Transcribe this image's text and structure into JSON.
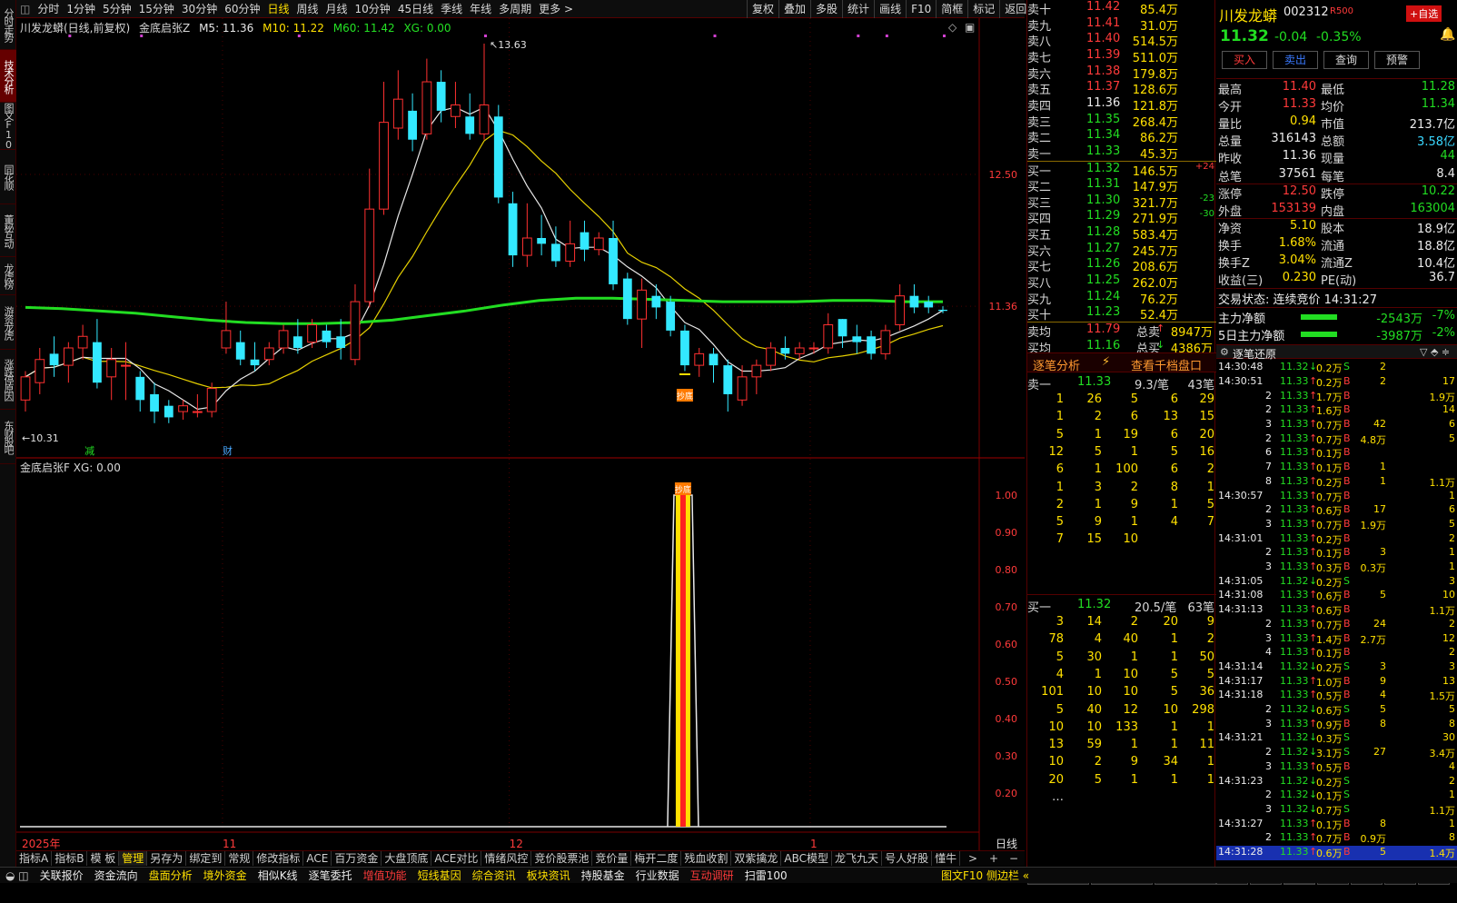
{
  "left_tabs": [
    "分时走势",
    "技术分析",
    "图文F10",
    "同花顺F10",
    "董秘互动",
    "龙虎榜",
    "游资龙虎",
    "涨跌停原因",
    "东财股吧"
  ],
  "periods": [
    "分时",
    "1分钟",
    "5分钟",
    "15分钟",
    "30分钟",
    "60分钟",
    "日线",
    "周线",
    "月线",
    "10分钟",
    "45日线",
    "季线",
    "年线",
    "多周期",
    "更多 >"
  ],
  "active_period": "日线",
  "right_tools": [
    "复权",
    "叠加",
    "多股",
    "统计",
    "画线",
    "F10",
    "简框",
    "标记",
    "返回"
  ],
  "chart_header": {
    "title": "川发龙蟒(日线,前复权)",
    "indicator": "金底启张Z",
    "m5": "M5: 11.36",
    "m10": "M10: 11.22",
    "m60": "M60: 11.42",
    "xg": "XG: 0.00"
  },
  "sub_header": {
    "indicator": "金底启张F",
    "xg": "XG: 0.00"
  },
  "price_axis": [
    {
      "v": "12.50",
      "p": 12.5
    },
    {
      "v": "11.36",
      "p": 11.36
    }
  ],
  "hi_label": "13.63",
  "lo_label": "10.31",
  "markers": {
    "jian": "减",
    "cai": "财",
    "chaodi": "抄底"
  },
  "sub_axis": [
    "1.00",
    "0.90",
    "0.80",
    "0.70",
    "0.60",
    "0.50",
    "0.40",
    "0.30",
    "0.20"
  ],
  "date_labels": [
    {
      "t": "2025年",
      "i": 0
    },
    {
      "t": "11",
      "i": 14
    },
    {
      "t": "12",
      "i": 34
    },
    {
      "t": "1",
      "i": 55
    }
  ],
  "period_corner": "日线",
  "candles": [
    [
      10.55,
      10.75,
      10.45,
      10.8
    ],
    [
      10.7,
      10.9,
      10.6,
      11.0
    ],
    [
      10.95,
      10.85,
      10.75,
      11.1
    ],
    [
      10.85,
      11.0,
      10.7,
      11.05
    ],
    [
      11.0,
      11.1,
      10.9,
      11.2
    ],
    [
      11.05,
      10.7,
      10.65,
      11.25
    ],
    [
      10.75,
      10.9,
      10.55,
      11.0
    ],
    [
      10.85,
      10.85,
      10.55,
      11.05
    ],
    [
      10.75,
      10.55,
      10.45,
      10.8
    ],
    [
      10.6,
      10.45,
      10.35,
      10.7
    ],
    [
      10.5,
      10.4,
      10.35,
      10.55
    ],
    [
      10.45,
      10.5,
      10.38,
      10.55
    ],
    [
      10.45,
      10.45,
      10.4,
      10.6
    ],
    [
      10.45,
      10.65,
      10.4,
      10.7
    ],
    [
      11.0,
      11.15,
      10.95,
      11.4
    ],
    [
      11.05,
      10.9,
      10.85,
      11.15
    ],
    [
      10.9,
      10.85,
      10.8,
      11.05
    ],
    [
      10.9,
      11.0,
      10.85,
      11.05
    ],
    [
      11.0,
      11.15,
      10.95,
      11.2
    ],
    [
      11.1,
      11.0,
      10.95,
      11.25
    ],
    [
      11.05,
      11.2,
      11.0,
      11.25
    ],
    [
      11.15,
      11.05,
      11.0,
      11.2
    ],
    [
      11.1,
      11.0,
      10.9,
      11.25
    ],
    [
      10.9,
      11.4,
      10.85,
      11.55
    ],
    [
      11.4,
      12.2,
      11.35,
      12.55
    ],
    [
      12.2,
      12.95,
      12.15,
      13.3
    ],
    [
      12.9,
      13.15,
      12.8,
      13.4
    ],
    [
      13.05,
      12.8,
      12.7,
      13.2
    ],
    [
      12.85,
      13.3,
      12.8,
      13.5
    ],
    [
      13.3,
      13.05,
      12.95,
      13.4
    ],
    [
      13.0,
      13.1,
      12.9,
      13.3
    ],
    [
      13.0,
      12.85,
      12.8,
      13.2
    ],
    [
      12.85,
      13.1,
      12.8,
      13.63
    ],
    [
      13.0,
      12.3,
      12.25,
      13.1
    ],
    [
      12.25,
      11.8,
      11.7,
      12.35
    ],
    [
      11.8,
      11.95,
      11.7,
      12.25
    ],
    [
      11.95,
      11.9,
      11.8,
      12.15
    ],
    [
      11.9,
      11.75,
      11.7,
      12.05
    ],
    [
      11.75,
      11.9,
      11.7,
      12.1
    ],
    [
      12.0,
      11.85,
      11.75,
      12.1
    ],
    [
      11.85,
      11.95,
      11.8,
      12.0
    ],
    [
      11.95,
      11.55,
      11.5,
      12.1
    ],
    [
      11.6,
      11.25,
      11.2,
      11.65
    ],
    [
      11.25,
      11.5,
      11.0,
      11.6
    ],
    [
      11.45,
      11.35,
      11.25,
      11.55
    ],
    [
      11.4,
      11.15,
      11.1,
      11.45
    ],
    [
      11.15,
      10.85,
      10.8,
      11.2
    ],
    [
      10.85,
      10.95,
      10.75,
      11.0
    ],
    [
      10.95,
      10.85,
      10.7,
      11.0
    ],
    [
      10.85,
      10.6,
      10.45,
      10.9
    ],
    [
      10.55,
      10.75,
      10.5,
      10.85
    ],
    [
      10.75,
      10.85,
      10.6,
      10.9
    ],
    [
      10.85,
      11.0,
      10.8,
      11.05
    ],
    [
      11.0,
      10.95,
      10.9,
      11.1
    ],
    [
      10.95,
      11.0,
      10.9,
      11.05
    ],
    [
      11.0,
      11.0,
      10.95,
      11.05
    ],
    [
      11.0,
      11.2,
      10.95,
      11.3
    ],
    [
      11.25,
      11.1,
      11.0,
      11.25
    ],
    [
      11.1,
      11.05,
      10.95,
      11.2
    ],
    [
      11.1,
      10.95,
      10.9,
      11.15
    ],
    [
      10.95,
      11.15,
      10.9,
      11.2
    ],
    [
      11.2,
      11.45,
      11.15,
      11.55
    ],
    [
      11.45,
      11.35,
      11.3,
      11.55
    ],
    [
      11.4,
      11.35,
      11.3,
      11.45
    ],
    [
      11.33,
      11.32,
      11.3,
      11.36
    ]
  ],
  "m60_line": [
    11.35,
    11.34,
    11.32,
    11.3,
    11.27,
    11.24,
    11.22,
    11.21,
    11.21,
    11.22,
    11.24,
    11.28,
    11.32,
    11.37,
    11.41,
    11.43,
    11.43,
    11.42,
    11.41,
    11.4,
    11.4,
    11.4,
    11.41,
    11.41,
    11.4,
    11.4
  ],
  "orderbook": {
    "asks": [
      [
        "卖十",
        "11.42",
        "85.4万"
      ],
      [
        "卖九",
        "11.41",
        "31.0万"
      ],
      [
        "卖八",
        "11.40",
        "514.5万"
      ],
      [
        "卖七",
        "11.39",
        "511.0万"
      ],
      [
        "卖六",
        "11.38",
        "179.8万"
      ],
      [
        "卖五",
        "11.37",
        "128.6万"
      ],
      [
        "卖四",
        "11.36",
        "121.8万"
      ],
      [
        "卖三",
        "11.35",
        "268.4万"
      ],
      [
        "卖二",
        "11.34",
        "86.2万"
      ],
      [
        "卖一",
        "11.33",
        "45.3万"
      ]
    ],
    "bids": [
      [
        "买一",
        "11.32",
        "146.5万",
        "+24"
      ],
      [
        "买二",
        "11.31",
        "147.9万",
        ""
      ],
      [
        "买三",
        "11.30",
        "321.7万",
        "-23"
      ],
      [
        "买四",
        "11.29",
        "271.9万",
        "-30"
      ],
      [
        "买五",
        "11.28",
        "583.4万",
        ""
      ],
      [
        "买六",
        "11.27",
        "245.7万",
        ""
      ],
      [
        "买七",
        "11.26",
        "208.6万",
        ""
      ],
      [
        "买八",
        "11.25",
        "262.0万",
        ""
      ],
      [
        "买九",
        "11.24",
        "76.2万",
        ""
      ],
      [
        "买十",
        "11.23",
        "52.4万",
        ""
      ]
    ],
    "avg_sell": [
      "卖均",
      "11.79",
      "总卖",
      "8947万"
    ],
    "avg_buy": [
      "买均",
      "11.16",
      "总买",
      "4386万"
    ],
    "zb_title": "逐笔分析",
    "zb_link": "查看千档盘口",
    "sell1_head": [
      "卖一",
      "11.33",
      "9.3/笔",
      "43笔"
    ],
    "sell1_grid": [
      [
        "1",
        "26",
        "5",
        "6",
        "29"
      ],
      [
        "1",
        "2",
        "6",
        "13",
        "15"
      ],
      [
        "5",
        "1",
        "19",
        "6",
        "20"
      ],
      [
        "12",
        "5",
        "1",
        "5",
        "16"
      ],
      [
        "6",
        "1",
        "100",
        "6",
        "2"
      ],
      [
        "1",
        "3",
        "2",
        "8",
        "1"
      ],
      [
        "2",
        "1",
        "9",
        "1",
        "5"
      ],
      [
        "5",
        "9",
        "1",
        "4",
        "7"
      ],
      [
        "7",
        "15",
        "10",
        "",
        ""
      ]
    ],
    "buy1_head": [
      "买一",
      "11.32",
      "20.5/笔",
      "63笔"
    ],
    "buy1_grid": [
      [
        "3",
        "14",
        "2",
        "20",
        "9"
      ],
      [
        "78",
        "4",
        "40",
        "1",
        "2"
      ],
      [
        "5",
        "30",
        "1",
        "1",
        "50"
      ],
      [
        "4",
        "1",
        "10",
        "5",
        "5"
      ],
      [
        "101",
        "10",
        "10",
        "5",
        "36"
      ],
      [
        "5",
        "40",
        "12",
        "10",
        "298"
      ],
      [
        "10",
        "10",
        "133",
        "1",
        "1"
      ],
      [
        "13",
        "59",
        "1",
        "1",
        "11"
      ],
      [
        "10",
        "2",
        "9",
        "34",
        "1"
      ],
      [
        "20",
        "5",
        "1",
        "1",
        "1"
      ],
      [
        "…",
        "",
        "",
        "",
        ""
      ]
    ]
  },
  "info": {
    "name": "川发龙蟒",
    "code": "002312",
    "tag": "R500",
    "add_btn": "+自选",
    "price": "11.32",
    "chg": "-0.04",
    "pct": "-0.35%",
    "btns": [
      "买入",
      "卖出",
      "查询",
      "预警"
    ],
    "stats": [
      [
        "最高",
        "11.40",
        "最低",
        "11.28"
      ],
      [
        "今开",
        "11.33",
        "均价",
        "11.34"
      ],
      [
        "量比",
        "0.94",
        "市值",
        "213.7亿"
      ],
      [
        "总量",
        "316143",
        "总额",
        "3.58亿"
      ],
      [
        "昨收",
        "11.36",
        "现量",
        "44"
      ],
      [
        "总笔",
        "37561",
        "每笔",
        "8.4"
      ],
      [
        "涨停",
        "12.50",
        "跌停",
        "10.22"
      ],
      [
        "外盘",
        "153139",
        "内盘",
        "163004"
      ],
      [
        "净资",
        "5.10",
        "股本",
        "18.9亿"
      ],
      [
        "换手",
        "1.68%",
        "流通",
        "18.8亿"
      ],
      [
        "换手Z",
        "3.04%",
        "流通Z",
        "10.4亿"
      ],
      [
        "收益(三)",
        "0.230",
        "PE(动)",
        "36.7"
      ]
    ],
    "trade_status": "交易状态: 连续竞价 14:31:27",
    "flow": [
      [
        "主力净额",
        "-2543万",
        "-7%"
      ],
      [
        "5日主力净额",
        "-3987万",
        "-2%"
      ]
    ],
    "tick_title": "逐笔还原",
    "ticks": [
      [
        "14:30:48",
        "11.32",
        "0.2万",
        "S",
        "2",
        ""
      ],
      [
        "14:30:51",
        "11.33",
        "0.2万",
        "B",
        "2",
        "17"
      ],
      [
        "2",
        "11.33",
        "1.7万",
        "B",
        "",
        "1.9万"
      ],
      [
        "2",
        "11.33",
        "1.6万",
        "B",
        "",
        "14"
      ],
      [
        "3",
        "11.33",
        "0.7万",
        "B",
        "42",
        "6"
      ],
      [
        "2",
        "11.33",
        "0.7万",
        "B",
        "4.8万",
        "5"
      ],
      [
        "6",
        "11.33",
        "0.1万",
        "B",
        "",
        ""
      ],
      [
        "7",
        "11.33",
        "0.1万",
        "B",
        "1",
        ""
      ],
      [
        "8",
        "11.33",
        "0.2万",
        "B",
        "1",
        "1.1万"
      ],
      [
        "14:30:57",
        "11.33",
        "0.7万",
        "B",
        "",
        "1"
      ],
      [
        "2",
        "11.33",
        "0.6万",
        "B",
        "17",
        "6"
      ],
      [
        "3",
        "11.33",
        "0.7万",
        "B",
        "1.9万",
        "5"
      ],
      [
        "14:31:01",
        "11.33",
        "0.2万",
        "B",
        "",
        "2"
      ],
      [
        "2",
        "11.33",
        "0.1万",
        "B",
        "3",
        "1"
      ],
      [
        "3",
        "11.33",
        "0.3万",
        "B",
        "0.3万",
        "1"
      ],
      [
        "14:31:05",
        "11.32",
        "0.2万",
        "S",
        "",
        "3"
      ],
      [
        "14:31:08",
        "11.33",
        "0.6万",
        "B",
        "5",
        "10"
      ],
      [
        "14:31:13",
        "11.33",
        "0.6万",
        "B",
        "",
        "1.1万"
      ],
      [
        "2",
        "11.33",
        "0.7万",
        "B",
        "24",
        "2"
      ],
      [
        "3",
        "11.33",
        "1.4万",
        "B",
        "2.7万",
        "12"
      ],
      [
        "4",
        "11.33",
        "0.1万",
        "B",
        "",
        "2"
      ],
      [
        "14:31:14",
        "11.32",
        "0.2万",
        "S",
        "3",
        "3"
      ],
      [
        "14:31:17",
        "11.33",
        "1.0万",
        "B",
        "9",
        "13"
      ],
      [
        "14:31:18",
        "11.33",
        "0.5万",
        "B",
        "4",
        "1.5万"
      ],
      [
        "2",
        "11.32",
        "0.6万",
        "S",
        "5",
        "5"
      ],
      [
        "3",
        "11.33",
        "0.9万",
        "B",
        "8",
        "8"
      ],
      [
        "14:31:21",
        "11.32",
        "0.3万",
        "S",
        "",
        "30"
      ],
      [
        "2",
        "11.32",
        "3.1万",
        "S",
        "27",
        "3.4万"
      ],
      [
        "3",
        "11.33",
        "0.5万",
        "B",
        "",
        "4"
      ],
      [
        "14:31:23",
        "11.32",
        "0.2万",
        "S",
        "",
        "2"
      ],
      [
        "2",
        "11.32",
        "0.1万",
        "S",
        "",
        "1"
      ],
      [
        "3",
        "11.32",
        "0.7万",
        "S",
        "",
        "1.1万"
      ],
      [
        "14:31:27",
        "11.33",
        "0.1万",
        "B",
        "8",
        "1"
      ],
      [
        "2",
        "11.33",
        "0.7万",
        "B",
        "0.9万",
        "8"
      ],
      [
        "14:31:28",
        "11.33",
        "0.6万",
        "B",
        "5",
        "1.4万"
      ]
    ]
  },
  "bottom_tabs": [
    "指标A",
    "指标B",
    "模 板",
    "管理",
    "另存为",
    "绑定到",
    "常规",
    "修改指标",
    "ACE",
    "百万资金",
    "大盘顶底",
    "ACE对比",
    "情绪风控",
    "竞价股票池",
    "竞价量",
    "梅开二度",
    "残血收割",
    "双紫擒龙",
    "ABC模型",
    "龙飞九天",
    "号人好股",
    "懂牛"
  ],
  "active_bottom_tab": "管理",
  "status_items": [
    "关联报价",
    "资金流向",
    "盘面分析",
    "境外资金",
    "相似K线",
    "逐笔委托",
    "增值功能",
    "短线基因",
    "综合资讯",
    "板块资讯",
    "持股基金",
    "行业数据",
    "互动调研",
    "扫雷100"
  ],
  "status_right": "图文F10 侧边栏 «",
  "right_bottom_tabs": [
    "队列",
    "分布",
    "龙虎"
  ],
  "right_bottom_small": [
    "笔",
    "价",
    "细",
    "势",
    "联",
    "逆",
    "筹"
  ]
}
